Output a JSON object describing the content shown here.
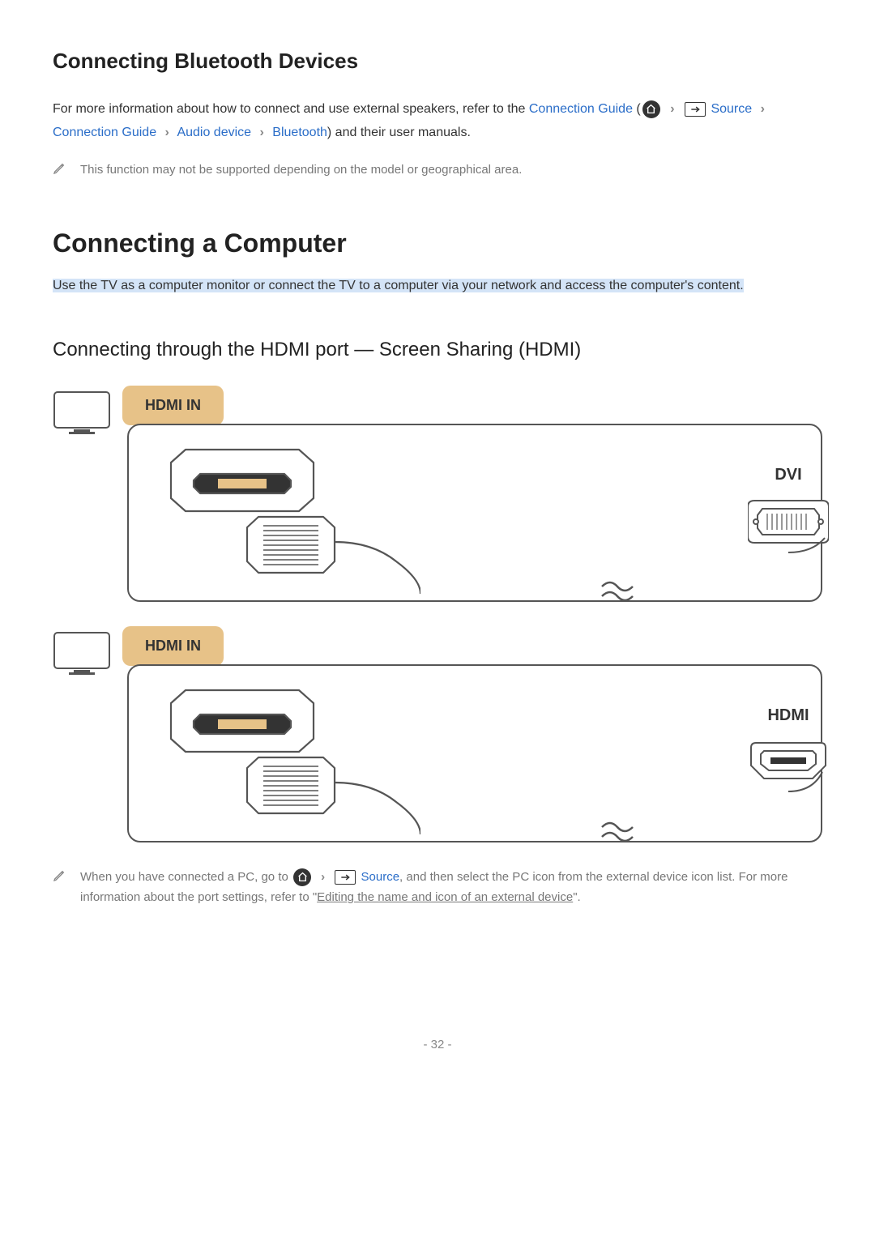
{
  "section1": {
    "heading": "Connecting Bluetooth Devices",
    "intro_pre": "For more information about how to connect and use external speakers, refer to the ",
    "connection_guide": "Connection Guide",
    "intro_paren_open": " (",
    "source": "Source",
    "audio_device": "Audio device",
    "bluetooth": "Bluetooth",
    "intro_post": ") and their user manuals.",
    "note": "This function may not be supported depending on the model or geographical area."
  },
  "section2": {
    "heading": "Connecting a Computer",
    "intro": "Use the TV as a computer monitor or connect the TV to a computer via your network and access the computer's content."
  },
  "section3": {
    "heading": "Connecting through the HDMI port — Screen Sharing (HDMI)",
    "hdmi_in": "HDMI IN",
    "dvi": "DVI",
    "hdmi": "HDMI"
  },
  "bottom_note": {
    "pre": "When you have connected a PC, go to ",
    "source": "Source",
    "mid": ", and then select the PC icon from the external device icon list. For more information about the port settings, refer to \"",
    "xref": "Editing the name and icon of an external device",
    "post": "\"."
  },
  "page": "- 32 -"
}
